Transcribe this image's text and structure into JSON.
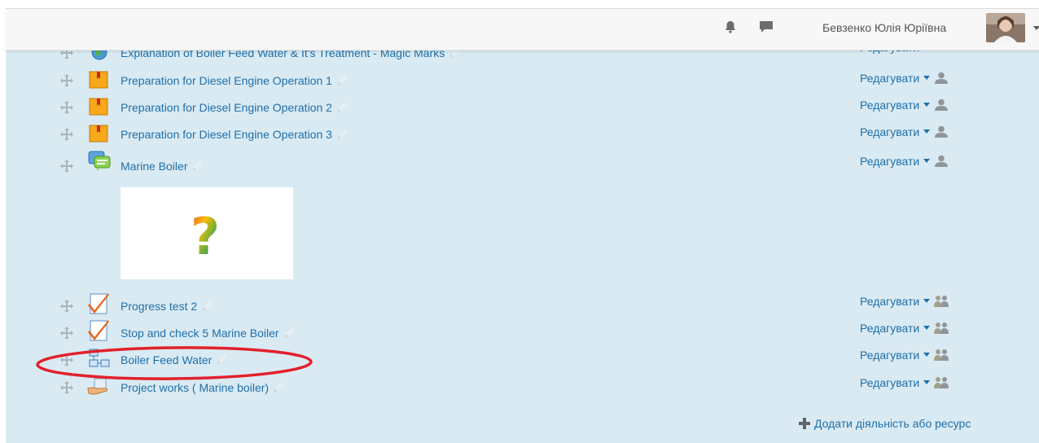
{
  "header": {
    "user_name": "Бевзенко Юлія Юріївна",
    "icons": [
      "bell-icon",
      "chat-icon"
    ]
  },
  "activities": [
    {
      "title": "Explanation of Boiler Feed Water & It's Treatment - Magic Marks",
      "icon": "url-globe-icon",
      "edit_label": "Редагувати",
      "group_mode": "none"
    },
    {
      "title": "Preparation for Diesel Engine Operation 1",
      "icon": "book-icon",
      "edit_label": "Редагувати",
      "group_mode": "single-user"
    },
    {
      "title": "Preparation for Diesel Engine Operation 2",
      "icon": "book-icon",
      "edit_label": "Редагувати",
      "group_mode": "single-user"
    },
    {
      "title": "Preparation for Diesel Engine Operation 3",
      "icon": "book-icon",
      "edit_label": "Редагувати",
      "group_mode": "single-user"
    },
    {
      "title": "Marine Boiler",
      "icon": "forum-icon",
      "edit_label": "Редагувати",
      "group_mode": "single-user"
    },
    {
      "title": "Progress test 2",
      "icon": "quiz-check-icon",
      "edit_label": "Редагувати",
      "group_mode": "groups"
    },
    {
      "title": "Stop and check 5 Marine Boiler",
      "icon": "quiz-check-icon",
      "edit_label": "Редагувати",
      "group_mode": "groups"
    },
    {
      "title": "Boiler Feed Water",
      "icon": "lesson-flow-icon",
      "edit_label": "Редагувати",
      "group_mode": "groups",
      "highlighted": true
    },
    {
      "title": "Project works ( Marine boiler)",
      "icon": "assignment-hand-icon",
      "edit_label": "Редагувати",
      "group_mode": "groups"
    }
  ],
  "media": {
    "icon": "question-mark-icon",
    "glyph": "?"
  },
  "footer": {
    "add_activity_label": "Додати діяльність або ресурс"
  },
  "colors": {
    "link": "#1f6fa8",
    "section_bg": "#d9eaf3",
    "highlight_ellipse": "#e3202b"
  }
}
